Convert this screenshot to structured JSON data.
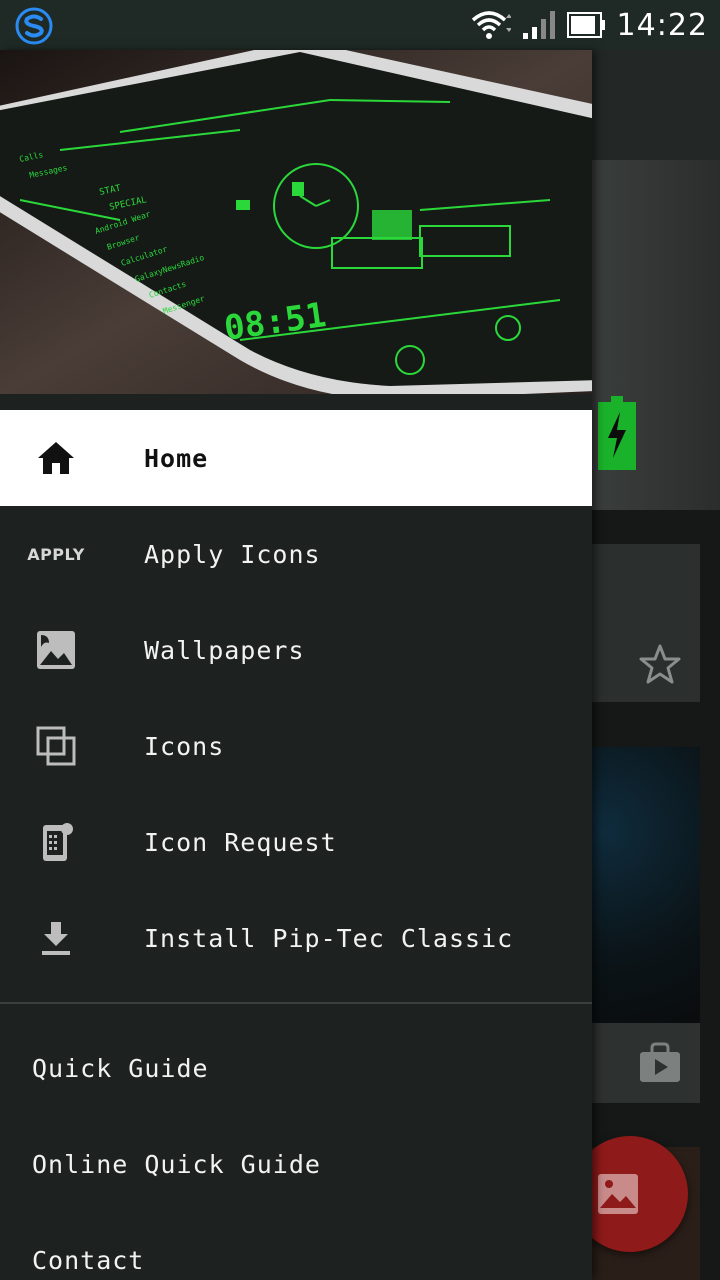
{
  "status_bar": {
    "time": "14:22"
  },
  "drawer": {
    "items": [
      {
        "label": "Home",
        "icon": "home-icon",
        "active": true
      },
      {
        "label": "Apply Icons",
        "icon_text": "APPLY"
      },
      {
        "label": "Wallpapers",
        "icon": "wallpaper-icon"
      },
      {
        "label": "Icons",
        "icon": "icons-stack-icon"
      },
      {
        "label": "Icon Request",
        "icon": "icon-request-icon"
      },
      {
        "label": "Install Pip-Tec Classic",
        "icon": "download-icon"
      }
    ],
    "sub_items": [
      {
        "label": "Quick Guide"
      },
      {
        "label": "Online Quick Guide"
      },
      {
        "label": "Contact"
      }
    ]
  },
  "header_image": {
    "clock": "08:51",
    "list": [
      "Android Wear",
      "Browser",
      "Calculator",
      "GalaxyNewsRadio",
      "Contacts",
      "Messenger"
    ],
    "labels": [
      "STAT",
      "SPECIAL",
      "Messages",
      "Calls"
    ]
  },
  "colors": {
    "accent_green": "#2bd83a",
    "drawer_bg": "#1d211f",
    "fab": "#8f1a1a"
  }
}
